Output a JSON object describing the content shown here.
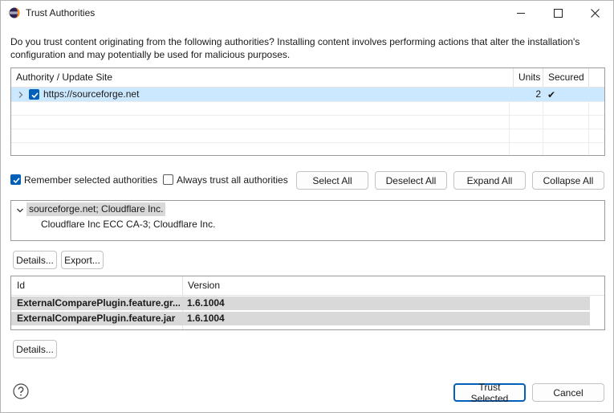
{
  "window": {
    "title": "Trust Authorities",
    "icon": "eclipse-icon",
    "controls": [
      "minimize-icon",
      "maximize-icon",
      "close-icon"
    ]
  },
  "intro": "Do you trust content originating from the following authorities?  Installing content involves performing actions that alter the installation's configuration and may potentially be used for malicious purposes.",
  "authorities": {
    "columns": [
      "Authority / Update Site",
      "Units",
      "Secured"
    ],
    "rows": [
      {
        "site": "https://sourceforge.net",
        "units": "2",
        "secured": "✔",
        "checked": true,
        "expanded": false
      }
    ]
  },
  "options": {
    "remember_label": "Remember selected authorities",
    "remember_checked": true,
    "always_trust_label": "Always trust all authorities",
    "always_trust_checked": false
  },
  "buttons": {
    "select_all": "Select All",
    "deselect_all": "Deselect All",
    "expand_all": "Expand All",
    "collapse_all": "Collapse All",
    "details": "Details...",
    "export": "Export...",
    "details2": "Details...",
    "trust_selected": "Trust Selected",
    "cancel": "Cancel"
  },
  "certificates": {
    "root": "sourceforge.net; Cloudflare Inc.",
    "child": "Cloudflare Inc ECC CA-3; Cloudflare Inc."
  },
  "units": {
    "columns": [
      "Id",
      "Version"
    ],
    "rows": [
      {
        "id": "ExternalComparePlugin.feature.gr...",
        "version": "1.6.1004"
      },
      {
        "id": "ExternalComparePlugin.feature.jar",
        "version": "1.6.1004"
      }
    ]
  },
  "help_icon": "help-icon",
  "colors": {
    "accent": "#005fb8",
    "selection": "#cce8ff",
    "inactive_selection": "#d9d9d9"
  }
}
